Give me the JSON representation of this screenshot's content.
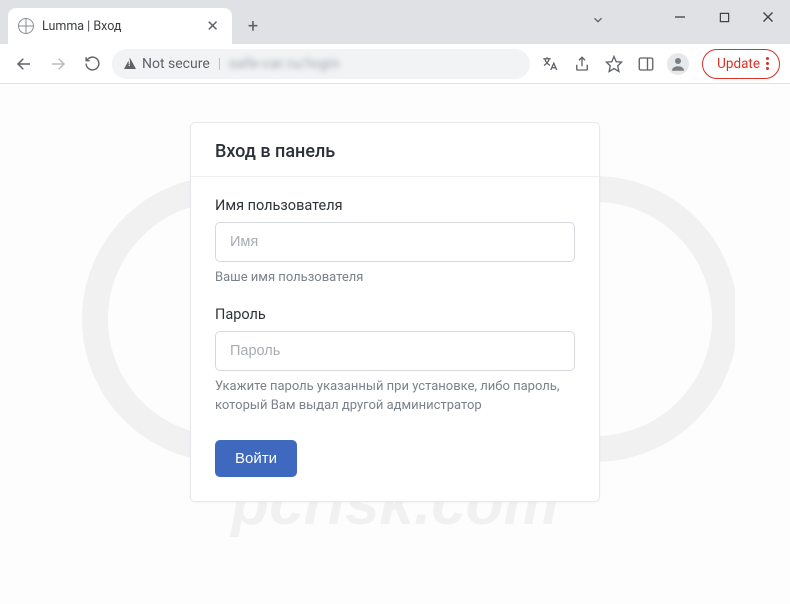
{
  "browser": {
    "tab_title": "Lumma | Вход",
    "not_secure_label": "Not secure",
    "url_masked": "safe-car.ru/login",
    "update_label": "Update"
  },
  "login": {
    "panel_title": "Вход в панель",
    "username": {
      "label": "Имя пользователя",
      "placeholder": "Имя",
      "help": "Ваше имя пользователя"
    },
    "password": {
      "label": "Пароль",
      "placeholder": "Пароль",
      "help": "Укажите пароль указанный при установке, либо пароль, который Вам выдал другой администратор"
    },
    "submit_label": "Войти"
  },
  "watermark": {
    "text": "pcrisk.com"
  }
}
